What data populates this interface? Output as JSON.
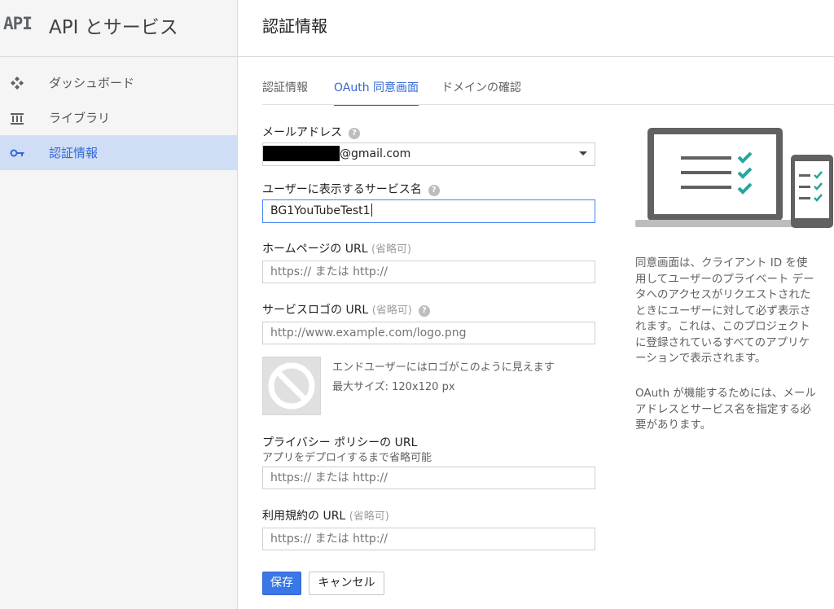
{
  "brand": {
    "logo": "API",
    "title": "API とサービス"
  },
  "sidebar": {
    "items": [
      {
        "label": "ダッシュボード",
        "icon": "dashboard-icon",
        "active": false
      },
      {
        "label": "ライブラリ",
        "icon": "library-icon",
        "active": false
      },
      {
        "label": "認証情報",
        "icon": "key-icon",
        "active": true
      }
    ]
  },
  "header": {
    "title": "認証情報"
  },
  "tabs": [
    {
      "label": "認証情報",
      "active": false
    },
    {
      "label": "OAuth 同意画面",
      "active": true
    },
    {
      "label": "ドメインの確認",
      "active": false
    }
  ],
  "form": {
    "email": {
      "label": "メールアドレス",
      "value": "@gmail.com"
    },
    "service_name": {
      "label": "ユーザーに表示するサービス名",
      "value": "BG1YouTubeTest1"
    },
    "homepage": {
      "label": "ホームページの URL",
      "optional": "(省略可)",
      "placeholder": "https:// または http://"
    },
    "logo_url": {
      "label": "サービスロゴの URL",
      "optional": "(省略可)",
      "placeholder": "http://www.example.com/logo.png"
    },
    "logo_preview": {
      "note": "エンドユーザーにはロゴがこのように見えます",
      "max_size": "最大サイズ: 120x120 px"
    },
    "privacy": {
      "label": "プライバシー ポリシーの URL",
      "sublabel": "アプリをデプロイするまで省略可能",
      "placeholder": "https:// または http://"
    },
    "terms": {
      "label": "利用規約の URL",
      "optional": "(省略可)",
      "placeholder": "https:// または http://"
    },
    "save_label": "保存",
    "cancel_label": "キャンセル"
  },
  "info": {
    "paragraph1_lines": [
      "同意画面は、クライアント ID を使",
      "用してユーザーのプライベート デー",
      "タへのアクセスがリクエストされた",
      "ときにユーザーに対して必ず表示さ",
      "れます。これは、このプロジェクト",
      "に登録されているすべてのアプリケ",
      "ーションで表示されます。"
    ],
    "paragraph2_lines": [
      "OAuth が機能するためには、メール",
      "アドレスとサービス名を指定する必",
      "要があります。"
    ]
  },
  "colors": {
    "accent": "#3367d6",
    "active_bg": "#d0def5",
    "check": "#26a69a",
    "device": "#616161"
  }
}
